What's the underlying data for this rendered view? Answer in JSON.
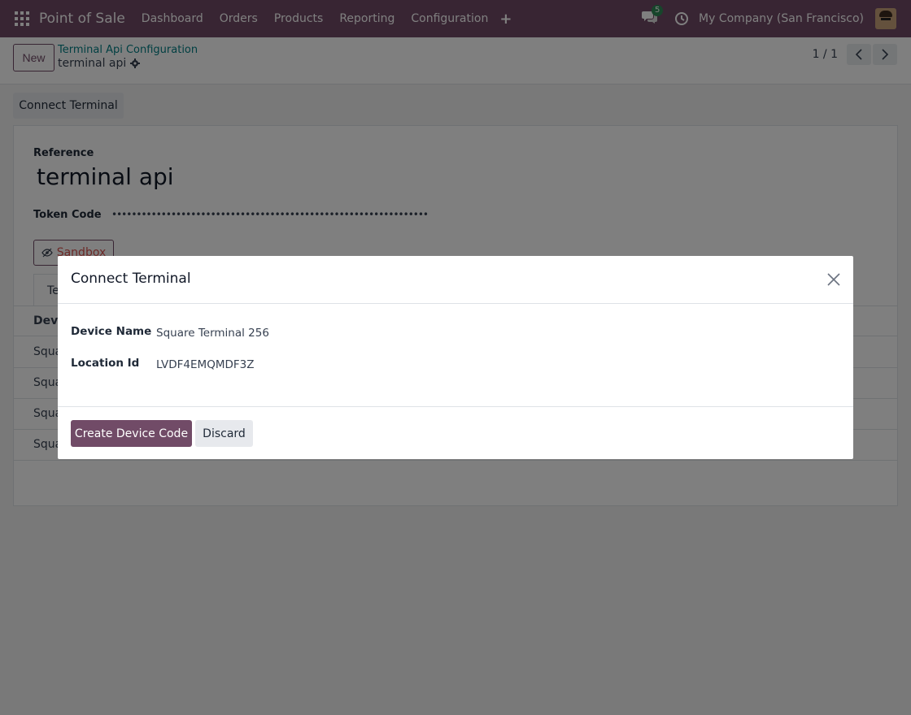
{
  "navbar": {
    "app_name": "Point of Sale",
    "menu": [
      "Dashboard",
      "Orders",
      "Products",
      "Reporting",
      "Configuration"
    ],
    "chat_count": "5",
    "company": "My Company (San Francisco)"
  },
  "control_panel": {
    "new_label": "New",
    "breadcrumb": "Terminal Api Configuration",
    "record_title": "terminal api",
    "pager": "1 / 1"
  },
  "form": {
    "connect_button": "Connect Terminal",
    "reference_label": "Reference",
    "reference_value": "terminal api",
    "token_label": "Token Code",
    "token_value": "••••••••••••••••••••••••••••••••••••••••••••••••••••••••••••••••",
    "sandbox_label": "Sandbox",
    "tab_label": "Te",
    "table_header": "Devi",
    "rows": [
      "Squa",
      "Squa",
      "Squa",
      "Squa"
    ]
  },
  "modal": {
    "title": "Connect Terminal",
    "device_name_label": "Device Name",
    "device_name_value": "Square Terminal 256",
    "location_id_label": "Location Id",
    "location_id_value": "LVDF4EMQMDF3Z",
    "create_button": "Create Device Code",
    "discard_button": "Discard"
  }
}
